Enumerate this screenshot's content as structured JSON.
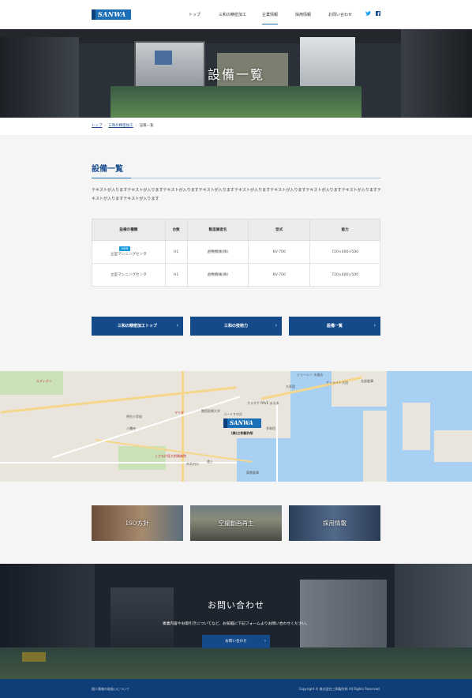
{
  "header": {
    "logo_text": "SANWA",
    "nav": [
      "トップ",
      "三和の精密加工",
      "企業情報",
      "採用情報",
      "お問い合わせ"
    ],
    "active_nav": "企業情報",
    "sns": [
      "twitter-icon",
      "facebook-icon"
    ]
  },
  "hero": {
    "title": "設備一覧"
  },
  "breadcrumb": {
    "items": [
      "トップ",
      "三和の精密加工",
      "設備一覧"
    ]
  },
  "section": {
    "title": "設備一覧",
    "lead": "テキストが入りますテキストが入りますテキストが入りますテキストが入りますテキストが入りますテキストが入りますテキストが入りますテキストが入りますテキストが入りますテキストが入ります"
  },
  "table": {
    "headers": [
      "設備の種類",
      "台数",
      "製造業者名",
      "型式",
      "能力"
    ],
    "rows": [
      {
        "badge": "NEW",
        "type": "立型マシニングセンタ",
        "count": "H1",
        "maker": "倉敷機械(株)",
        "model": "KV-700",
        "capacity": "720×400×500"
      },
      {
        "badge": "",
        "type": "立型マシニングセンタ",
        "count": "H1",
        "maker": "倉敷機械(株)",
        "model": "KV-700",
        "capacity": "720×400×500"
      }
    ]
  },
  "buttons": [
    "三和の精密加工トップ",
    "三和の技術力",
    "設備一覧"
  ],
  "map": {
    "logo_text": "SANWA",
    "company": "(株)三和製作所",
    "labels": [
      "ジョーシン 水島店",
      "エディオン",
      "サンライト大田",
      "北部倉庫",
      "大寿園",
      "カラオケ PAVE まるあ",
      "関西医療大学",
      "コードすの浜",
      "マツダ",
      "八幡寺",
      "くさわけ医大附属病院",
      "明光小学校",
      "多和田",
      "遠上",
      "市天内小",
      "東都倉庫"
    ]
  },
  "banners": [
    "ISO方針",
    "空撮動画再生",
    "採用情報"
  ],
  "contact": {
    "title": "お問い合わせ",
    "text": "事業内容やお取引きについてなど、お気軽に下記フォームよりお問い合わせください。",
    "button": "お問い合わせ"
  },
  "footer": {
    "left": "個人情報の取扱いについて",
    "right": "Copyright © 株式会社三和製作所 All Rights Reserved."
  }
}
